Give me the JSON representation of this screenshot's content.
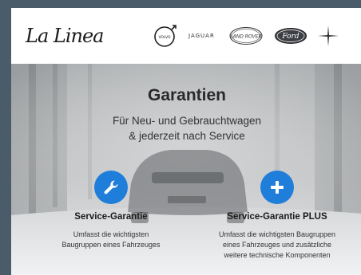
{
  "header": {
    "logo_text": "La Linea",
    "brands": [
      {
        "name": "VOLVO",
        "icon": "volvo-logo-icon"
      },
      {
        "name": "JAGUAR",
        "icon": "jaguar-wordmark"
      },
      {
        "name": "LAND ROVER",
        "icon": "land-rover-logo-icon"
      },
      {
        "name": "Ford",
        "icon": "ford-logo-icon"
      },
      {
        "name": "",
        "icon": "polestar-logo-icon"
      }
    ]
  },
  "hero": {
    "title": "Garantien",
    "subtitle_line1": "Für Neu- und Gebrauchtwagen",
    "subtitle_line2": "& jederzeit nach Service"
  },
  "features": [
    {
      "icon": "wrench-icon",
      "title": "Service-Garantie",
      "desc_line1": "Umfasst die wichtigsten",
      "desc_line2": "Baugruppen eines Fahrzeuges",
      "desc_line3": ""
    },
    {
      "icon": "plus-icon",
      "title": "Service-Garantie PLUS",
      "desc_line1": "Umfasst die wichtigsten Baugruppen",
      "desc_line2": "eines Fahrzeuges und zusätzliche",
      "desc_line3": "weitere technische Komponenten"
    }
  ],
  "colors": {
    "accent": "#1f7ed9",
    "page_border": "#4a5b6a"
  }
}
